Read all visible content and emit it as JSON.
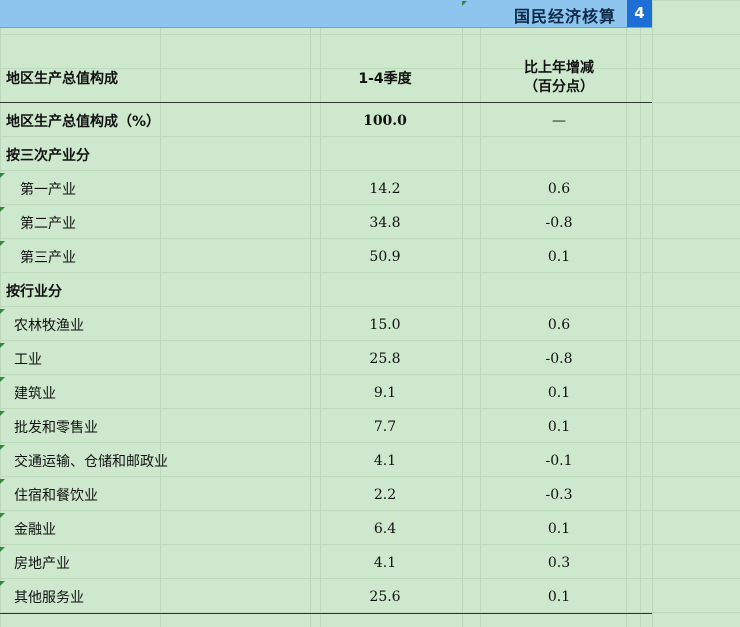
{
  "header": {
    "title": "国民经济核算",
    "page_number": "4"
  },
  "table": {
    "columns": {
      "name": "地区生产总值构成",
      "period": "1-4季度",
      "change_line1": "比上年增减",
      "change_line2": "（百分点）"
    },
    "rows": [
      {
        "name": "地区生产总值构成（%）",
        "value": "100.0",
        "change": "—",
        "bold": true,
        "indent": 0
      },
      {
        "name": "按三次产业分",
        "value": "",
        "change": "",
        "bold": true,
        "indent": 0
      },
      {
        "name": "第一产业",
        "value": "14.2",
        "change": "0.6",
        "bold": false,
        "indent": 1
      },
      {
        "name": "第二产业",
        "value": "34.8",
        "change": "-0.8",
        "bold": false,
        "indent": 1
      },
      {
        "name": "第三产业",
        "value": "50.9",
        "change": "0.1",
        "bold": false,
        "indent": 1
      },
      {
        "name": "按行业分",
        "value": "",
        "change": "",
        "bold": true,
        "indent": 0
      },
      {
        "name": "农林牧渔业",
        "value": "15.0",
        "change": "0.6",
        "bold": false,
        "indent": 2
      },
      {
        "name": "工业",
        "value": "25.8",
        "change": "-0.8",
        "bold": false,
        "indent": 2
      },
      {
        "name": "建筑业",
        "value": "9.1",
        "change": "0.1",
        "bold": false,
        "indent": 2
      },
      {
        "name": "批发和零售业",
        "value": "7.7",
        "change": "0.1",
        "bold": false,
        "indent": 2
      },
      {
        "name": "交通运输、仓储和邮政业",
        "value": "4.1",
        "change": "-0.1",
        "bold": false,
        "indent": 2
      },
      {
        "name": "住宿和餐饮业",
        "value": "2.2",
        "change": "-0.3",
        "bold": false,
        "indent": 2
      },
      {
        "name": "金融业",
        "value": "6.4",
        "change": "0.1",
        "bold": false,
        "indent": 2
      },
      {
        "name": "房地产业",
        "value": "4.1",
        "change": "0.3",
        "bold": false,
        "indent": 2
      },
      {
        "name": "其他服务业",
        "value": "25.6",
        "change": "0.1",
        "bold": false,
        "indent": 2
      }
    ]
  },
  "colors": {
    "sheet_background": "#cde8cd",
    "title_bar": "#8ec5ee",
    "page_badge": "#1d6fd6",
    "cell_marker": "#2e8b3a"
  }
}
